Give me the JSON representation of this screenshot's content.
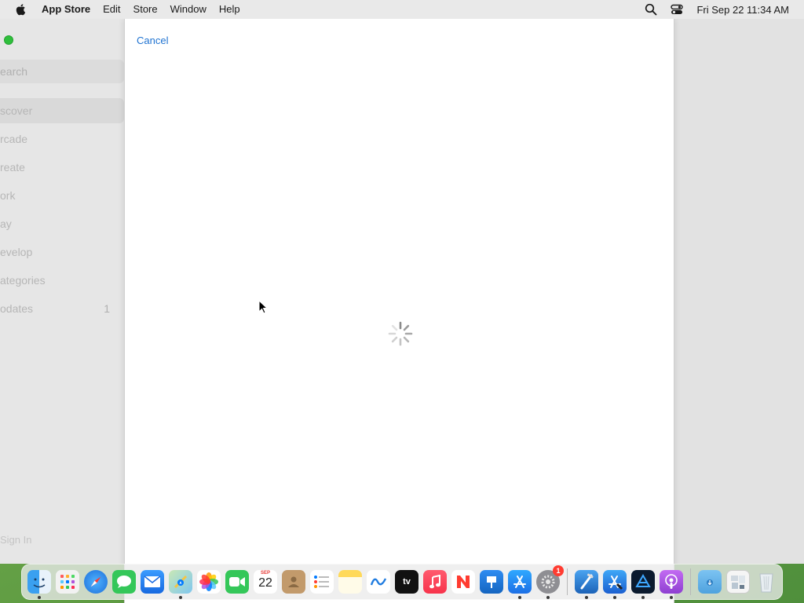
{
  "menubar": {
    "apple_icon": "apple-logo-icon",
    "app_name": "App Store",
    "items": [
      "Edit",
      "Store",
      "Window",
      "Help"
    ],
    "clock": "Fri Sep 22  11:34 AM"
  },
  "sidebar": {
    "search_placeholder": "earch",
    "items": [
      {
        "label": "scover"
      },
      {
        "label": "rcade"
      },
      {
        "label": "reate"
      },
      {
        "label": "ork"
      },
      {
        "label": "ay"
      },
      {
        "label": "evelop"
      },
      {
        "label": "ategories"
      },
      {
        "label": "odates",
        "badge": "1"
      }
    ],
    "sign_in": "Sign In"
  },
  "sheet": {
    "cancel_label": "Cancel",
    "loading": true
  },
  "dock": {
    "apps": [
      {
        "name": "finder",
        "running": true
      },
      {
        "name": "launchpad",
        "running": false
      },
      {
        "name": "safari",
        "running": false
      },
      {
        "name": "messages",
        "running": false
      },
      {
        "name": "mail",
        "running": false
      },
      {
        "name": "maps",
        "running": true
      },
      {
        "name": "photos",
        "running": false
      },
      {
        "name": "facetime",
        "running": false
      },
      {
        "name": "calendar",
        "running": false,
        "month": "SEP",
        "day": "22"
      },
      {
        "name": "contacts",
        "running": false
      },
      {
        "name": "reminders",
        "running": false
      },
      {
        "name": "notes",
        "running": false
      },
      {
        "name": "freeform",
        "running": false
      },
      {
        "name": "tv",
        "running": false,
        "label": "tv"
      },
      {
        "name": "music",
        "running": false
      },
      {
        "name": "news",
        "running": false
      },
      {
        "name": "keynote",
        "running": false
      },
      {
        "name": "app-store",
        "running": true
      },
      {
        "name": "system-settings",
        "running": true,
        "badge": "1"
      },
      {
        "name": "xcode",
        "running": true
      },
      {
        "name": "xcode-instruments",
        "running": true
      },
      {
        "name": "codeshot",
        "running": true
      },
      {
        "name": "podcasts",
        "running": true
      },
      {
        "name": "downloads-folder",
        "running": false
      },
      {
        "name": "documents-stack",
        "running": false
      },
      {
        "name": "trash",
        "running": false
      }
    ]
  },
  "colors": {
    "accent": "#1f73d1",
    "badge": "#ff3b30"
  }
}
